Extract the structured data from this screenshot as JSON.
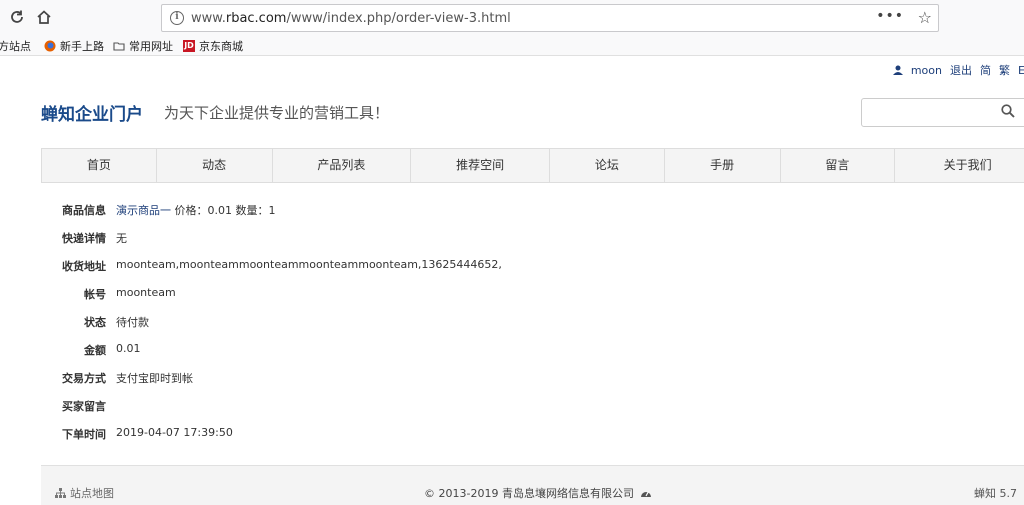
{
  "browser": {
    "url_prefix": "www.",
    "url_domain": "rbac.com",
    "url_path": "/www/index.php/order-view-3.html",
    "bookmarks": [
      {
        "label": "方站点",
        "icon": "partial-icon"
      },
      {
        "label": "新手上路",
        "icon": "firefox-icon"
      },
      {
        "label": "常用网址",
        "icon": "folder-icon"
      },
      {
        "label": "京东商城",
        "icon": "jd-icon"
      }
    ]
  },
  "userbar": {
    "username": "moon",
    "logout": "退出",
    "simplified": "简",
    "traditional": "繁",
    "extra": "E"
  },
  "header": {
    "logo": "蝉知企业门户",
    "slogan": "为天下企业提供专业的营销工具！"
  },
  "menu": [
    "首页",
    "动态",
    "产品列表",
    "推荐空间",
    "论坛",
    "手册",
    "留言",
    "关于我们"
  ],
  "order": {
    "product": {
      "label": "商品信息",
      "link": "演示商品一",
      "rest": " 价格：0.01 数量：1"
    },
    "shipping": {
      "label": "快递详情",
      "value": "无"
    },
    "address": {
      "label": "收货地址",
      "value": "moonteam,moonteammoonteammoonteammoonteam,13625444652,"
    },
    "account": {
      "label": "帐号",
      "value": "moonteam"
    },
    "status": {
      "label": "状态",
      "value": "待付款"
    },
    "amount": {
      "label": "金额",
      "value": "0.01"
    },
    "payment": {
      "label": "交易方式",
      "value": "支付宝即时到帐"
    },
    "note": {
      "label": "买家留言",
      "value": ""
    },
    "time": {
      "label": "下单时间",
      "value": "2019-04-07 17:39:50"
    }
  },
  "footer": {
    "sitemap": "站点地图",
    "copyright": "© 2013-2019 青岛息壤网络信息有限公司",
    "version": "蝉知 5.7"
  }
}
